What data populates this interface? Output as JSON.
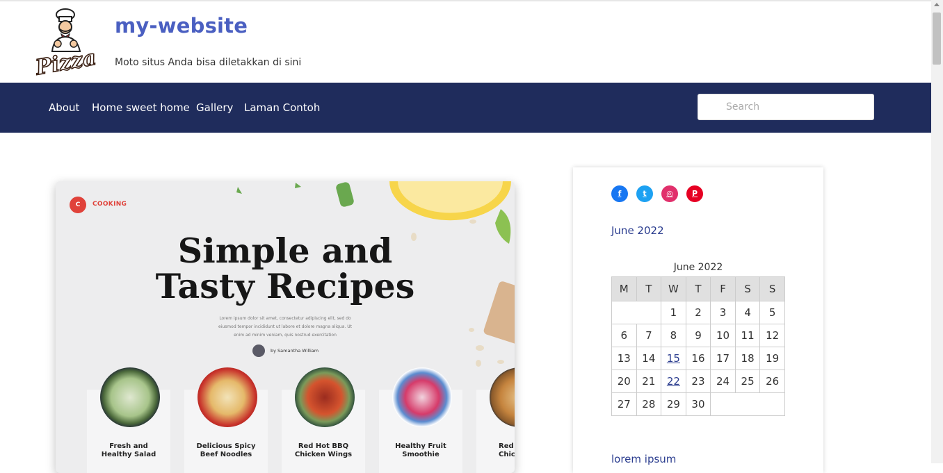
{
  "site": {
    "title": "my-website",
    "tagline": "Moto situs Anda bisa diletakkan di sini",
    "logo_text": "Pizza"
  },
  "nav": {
    "items": [
      {
        "label": "About"
      },
      {
        "label": "Home sweet home"
      },
      {
        "label": "Gallery"
      },
      {
        "label": "Laman Contoh"
      }
    ],
    "search_placeholder": "Search"
  },
  "colors": {
    "brand_title": "#4a5fc1",
    "navbar": "#1f2c5c",
    "link": "#2b3d8f",
    "accent_red": "#e0423a"
  },
  "featured": {
    "brand_badge": "C",
    "brand_name": "COOKING",
    "title_line1": "Simple and",
    "title_line2": "Tasty Recipes",
    "description": "Lorem ipsum dolor sit amet, consectetur adipiscing elit, sed do eiusmod tempor incididunt ut labore et dolore magna aliqua. Ut enim ad minim veniam, quis nostrud exercitation",
    "author": "by Samantha William",
    "recipes": [
      {
        "name_line1": "Fresh and",
        "name_line2": "Healthy Salad"
      },
      {
        "name_line1": "Delicious Spicy",
        "name_line2": "Beef Noodles"
      },
      {
        "name_line1": "Red Hot BBQ",
        "name_line2": "Chicken Wings"
      },
      {
        "name_line1": "Healthy Fruit",
        "name_line2": "Smoothie"
      },
      {
        "name_line1": "Red",
        "name_line2": "Chick"
      }
    ]
  },
  "sidebar": {
    "social": [
      {
        "icon": "facebook-icon",
        "glyph": "f",
        "color": "#1877f2"
      },
      {
        "icon": "twitter-icon",
        "glyph": "t",
        "color": "#1da1f2"
      },
      {
        "icon": "instagram-icon",
        "glyph": "◎",
        "color": "#e1306c"
      },
      {
        "icon": "pinterest-icon",
        "glyph": "P",
        "color": "#e60023"
      }
    ],
    "archive_link": "June 2022",
    "calendar": {
      "caption": "June 2022",
      "weekdays": [
        "M",
        "T",
        "W",
        "T",
        "F",
        "S",
        "S"
      ],
      "weeks": [
        [
          "",
          "",
          "1",
          "2",
          "3",
          "4",
          "5"
        ],
        [
          "6",
          "7",
          "8",
          "9",
          "10",
          "11",
          "12"
        ],
        [
          "13",
          "14",
          "15",
          "16",
          "17",
          "18",
          "19"
        ],
        [
          "20",
          "21",
          "22",
          "23",
          "24",
          "25",
          "26"
        ],
        [
          "27",
          "28",
          "29",
          "30",
          "",
          "",
          ""
        ]
      ],
      "linked_days": [
        "15",
        "22"
      ]
    },
    "recent_post_link": "lorem ipsum"
  }
}
